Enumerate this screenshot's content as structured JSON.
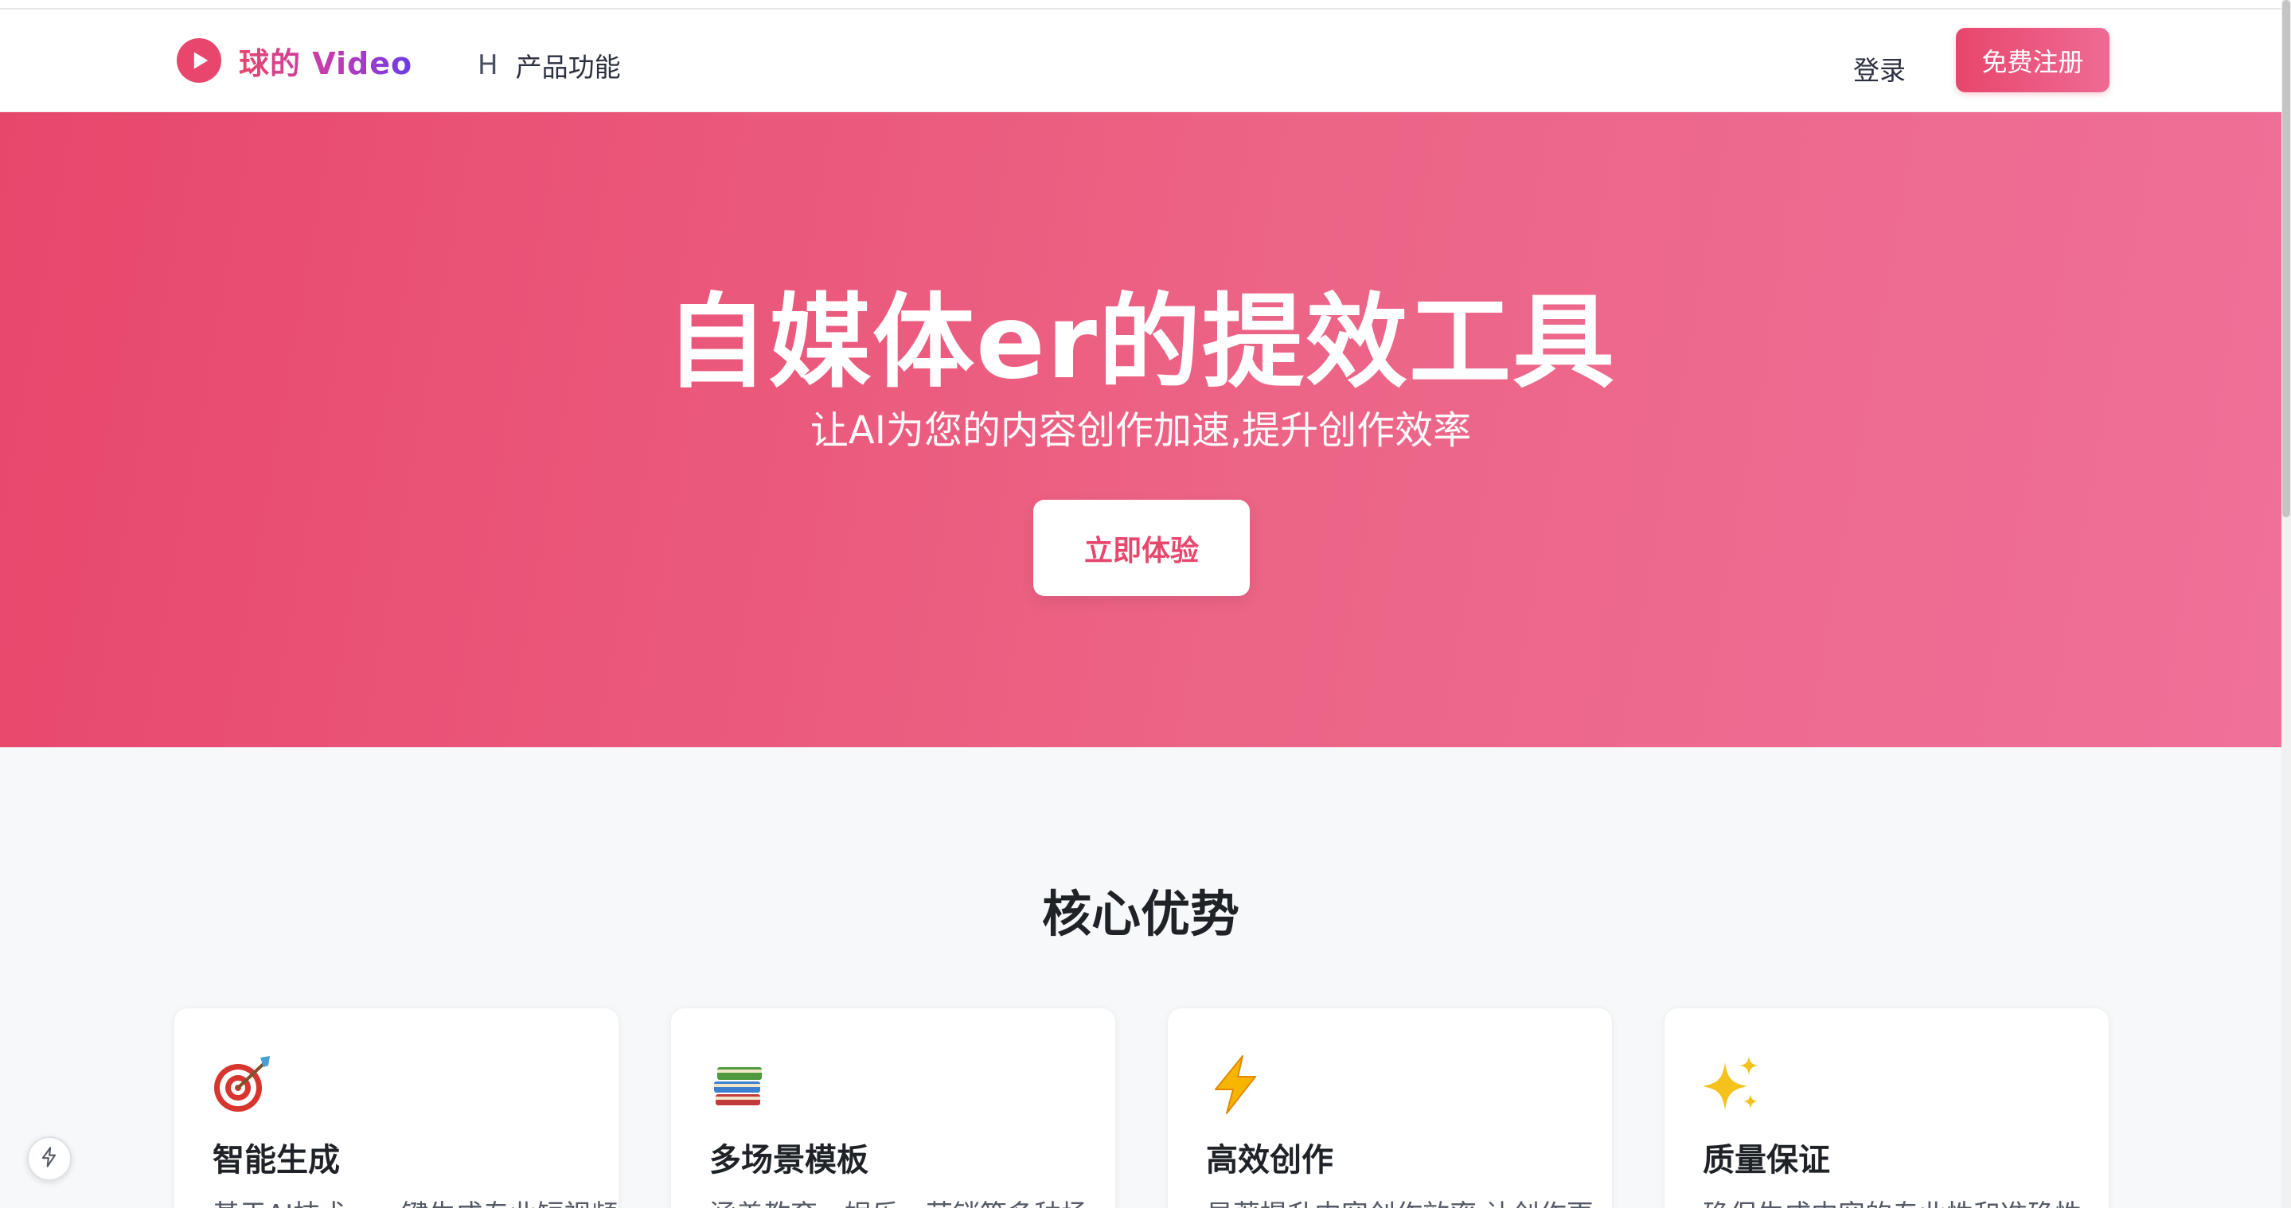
{
  "navbar": {
    "brand_name": "球的 Video",
    "nav_item_icon": "H",
    "nav_item_label": "产品功能",
    "login_label": "登录",
    "register_label": "免费注册"
  },
  "hero": {
    "title": "自媒体er的提效工具",
    "subtitle": "让AI为您的内容创作加速,提升创作效率",
    "cta_label": "立即体验"
  },
  "advantages": {
    "section_title": "核心优势",
    "cards": [
      {
        "icon": "target-icon",
        "title": "智能生成",
        "desc": "基于AI技术，一键生成专业短视频"
      },
      {
        "icon": "books-icon",
        "title": "多场景模板",
        "desc": "涵盖教育、娱乐、营销等多种场"
      },
      {
        "icon": "lightning-icon",
        "title": "高效创作",
        "desc": "显著提升内容创作效率,让创作更"
      },
      {
        "icon": "sparkles-icon",
        "title": "质量保证",
        "desc": "确保生成内容的专业性和准确性"
      }
    ]
  },
  "colors": {
    "brand": "#e8466c",
    "hero_gradient_start": "#e8476c",
    "hero_gradient_end": "#ef7099",
    "page_background": "#f7f8fa"
  },
  "icons": {
    "brand_logo": "play-circle-icon",
    "floating_button": "lightning-outline-icon"
  }
}
